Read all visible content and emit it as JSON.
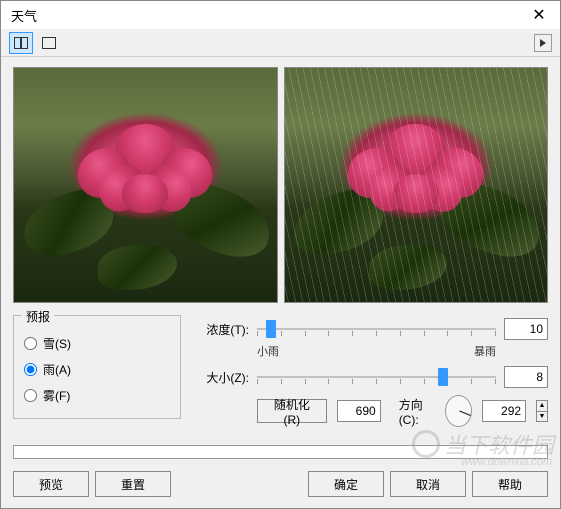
{
  "window": {
    "title": "天气"
  },
  "toolbar": {
    "view_split": "split-view",
    "view_single": "single-view",
    "play": "play"
  },
  "forecast": {
    "title": "预报",
    "options": [
      {
        "label": "雪(S)",
        "value": "snow",
        "checked": false
      },
      {
        "label": "雨(A)",
        "value": "rain",
        "checked": true
      },
      {
        "label": "雾(F)",
        "value": "fog",
        "checked": false
      }
    ]
  },
  "sliders": {
    "density": {
      "label": "浓度(T):",
      "value": "10",
      "min_label": "小雨",
      "max_label": "暴雨",
      "pos_pct": 6
    },
    "size": {
      "label": "大小(Z):",
      "value": "8",
      "pos_pct": 78
    }
  },
  "randomize": {
    "button": "随机化(R)",
    "value": "690"
  },
  "direction": {
    "label": "方向(C):",
    "value": "292"
  },
  "buttons": {
    "preview": "预览",
    "reset": "重置",
    "ok": "确定",
    "cancel": "取消",
    "help": "帮助"
  },
  "watermark": {
    "text": "当下软件园",
    "url": "www.downxia.com"
  }
}
